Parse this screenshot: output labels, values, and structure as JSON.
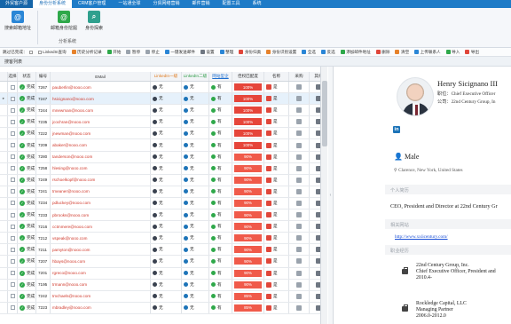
{
  "menubar": {
    "items": [
      "外贸客户源",
      "身份分析系统",
      "CRM客户管理",
      "一站通全球",
      "分贸网络营销",
      "邮件营销",
      "配置工具",
      "系统"
    ],
    "active_index": 1,
    "first_label": "外贸客户源"
  },
  "ribbon": {
    "btn1": "搜索邮箱地址",
    "btn2": "邮箱身份挖掘",
    "btn3": "身份探索",
    "group": "分析系统"
  },
  "toolbar": {
    "items": [
      "跳过已完成：",
      "LinkedIn查询",
      "历史分析记录",
      "开始",
      "暂停",
      "停止",
      "一键发送邮件",
      "设置",
      "整理",
      "身份归类",
      "身份识别设置",
      "全选",
      "反选",
      "添加邮件地址",
      "删除",
      "清空",
      "上传联系人",
      "导入",
      "导出"
    ]
  },
  "section_title": "搜客列表",
  "grid": {
    "headers": [
      "选择",
      "状态",
      "编号",
      "EMail",
      "LinkedIn一级",
      "LinkedIn二级",
      "网站型企",
      "佳权匹配度",
      "名称",
      "采购",
      "其他"
    ],
    "rows": [
      {
        "status": "完成",
        "no": "7267",
        "email": "pauberlin@nooo.com",
        "li1": "无",
        "li2": "无",
        "corp": "有",
        "rate": "100%",
        "nm": "是",
        "selected": false
      },
      {
        "status": "完成",
        "no": "7247",
        "email": "hsicignano@nooo.com",
        "li1": "无",
        "li2": "无",
        "corp": "有",
        "rate": "100%",
        "nm": "是",
        "selected": true
      },
      {
        "status": "完成",
        "no": "7244",
        "email": "mnewman@nooo.com",
        "li1": "无",
        "li2": "无",
        "corp": "有",
        "rate": "100%",
        "nm": "是",
        "selected": false
      },
      {
        "status": "完成",
        "no": "7235",
        "email": "jcochran@nooo.com",
        "li1": "无",
        "li2": "无",
        "corp": "有",
        "rate": "100%",
        "nm": "是",
        "selected": false
      },
      {
        "status": "完成",
        "no": "7222",
        "email": "jnewman@nooo.com",
        "li1": "无",
        "li2": "无",
        "corp": "有",
        "rate": "100%",
        "nm": "是",
        "selected": false
      },
      {
        "status": "完成",
        "no": "7209",
        "email": "abaker@nooo.com",
        "li1": "无",
        "li2": "无",
        "corp": "有",
        "rate": "100%",
        "nm": "是",
        "selected": false
      },
      {
        "status": "完成",
        "no": "7280",
        "email": "tanderson@nooo.com",
        "li1": "无",
        "li2": "无",
        "corp": "有",
        "rate": "90%",
        "nm": "是",
        "selected": false
      },
      {
        "status": "完成",
        "no": "7258",
        "email": "hlesing@nooo.com",
        "li1": "无",
        "li2": "无",
        "corp": "有",
        "rate": "90%",
        "nm": "是",
        "selected": false
      },
      {
        "status": "完成",
        "no": "7249",
        "email": "rschoelkopf@nooo.com",
        "li1": "无",
        "li2": "无",
        "corp": "有",
        "rate": "90%",
        "nm": "是",
        "selected": false
      },
      {
        "status": "完成",
        "no": "7241",
        "email": "tmeaner@nooo.com",
        "li1": "无",
        "li2": "无",
        "corp": "有",
        "rate": "90%",
        "nm": "是",
        "selected": false
      },
      {
        "status": "完成",
        "no": "7234",
        "email": "pdluckey@nooo.com",
        "li1": "无",
        "li2": "无",
        "corp": "有",
        "rate": "90%",
        "nm": "是",
        "selected": false
      },
      {
        "status": "完成",
        "no": "7233",
        "email": "pbrooks@nooo.com",
        "li1": "无",
        "li2": "无",
        "corp": "有",
        "rate": "90%",
        "nm": "是",
        "selected": false
      },
      {
        "status": "完成",
        "no": "7216",
        "email": "cctmmere@nooo.com",
        "li1": "无",
        "li2": "无",
        "corp": "有",
        "rate": "90%",
        "nm": "是",
        "selected": false
      },
      {
        "status": "完成",
        "no": "7212",
        "email": "vspeak@nooo.com",
        "li1": "无",
        "li2": "无",
        "corp": "有",
        "rate": "90%",
        "nm": "是",
        "selected": false
      },
      {
        "status": "完成",
        "no": "7211",
        "email": "pamyton@nooo.com",
        "li1": "无",
        "li2": "无",
        "corp": "有",
        "rate": "90%",
        "nm": "是",
        "selected": false
      },
      {
        "status": "完成",
        "no": "7207",
        "email": "hbays@nooo.com",
        "li1": "无",
        "li2": "无",
        "corp": "有",
        "rate": "90%",
        "nm": "是",
        "selected": false
      },
      {
        "status": "完成",
        "no": "7201",
        "email": "rgreco@nooo.com",
        "li1": "无",
        "li2": "无",
        "corp": "有",
        "rate": "90%",
        "nm": "是",
        "selected": false
      },
      {
        "status": "完成",
        "no": "7195",
        "email": "trmann@nooo.com",
        "li1": "无",
        "li2": "无",
        "corp": "有",
        "rate": "90%",
        "nm": "是",
        "selected": false
      },
      {
        "status": "完成",
        "no": "7242",
        "email": "tmchaels@nooo.com",
        "li1": "无",
        "li2": "无",
        "corp": "有",
        "rate": "85%",
        "nm": "是",
        "selected": false
      },
      {
        "status": "完成",
        "no": "7223",
        "email": "mbradley@nooo.com",
        "li1": "无",
        "li2": "无",
        "corp": "有",
        "rate": "85%",
        "nm": "是",
        "selected": false
      }
    ]
  },
  "profile": {
    "name": "Henry Sicignano III",
    "title_line": "职位：Chief Executive Officer",
    "company_line": "公司：22nd Century Group, In",
    "gender": "Male",
    "location": "Clarence, New York, United States",
    "sec_intro": "个人简历",
    "intro": "CEO, President and Director at 22nd Century Gr",
    "sec_site": "相关网站",
    "site": "http://www.xxiicentury.com/",
    "sec_jobs": "职业经历",
    "jobs": [
      {
        "l1": "22nd Century Group, Inc.",
        "l2": "Chief Executive Officer, President and",
        "l3": "2010.4-"
      },
      {
        "l1": "Rockledge Capital, LLC",
        "l2": "Managing Partner",
        "l3": "2006.0-2012.0"
      }
    ]
  },
  "colors": {
    "menubar": "#1e7bc7",
    "rate": "#f05a4a",
    "email": "#d0382b",
    "ok": "#2fa84a"
  }
}
